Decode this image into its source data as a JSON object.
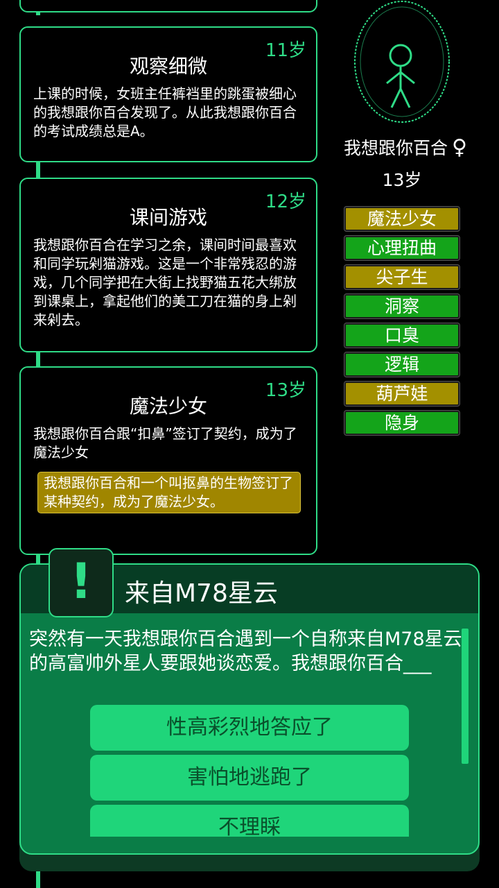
{
  "timeline": {
    "events": [
      {
        "age": "11岁",
        "title": "观察细微",
        "body": "上课的时候，女班主任裤裆里的跳蛋被细心的我想跟你百合发现了。从此我想跟你百合的考试成绩总是A。"
      },
      {
        "age": "12岁",
        "title": "课间游戏",
        "body": "我想跟你百合在学习之余，课间时间最喜欢和同学玩剁猫游戏。这是一个非常残忍的游戏，几个同学把在大街上找野猫五花大绑放到课桌上，拿起他们的美工刀在猫的身上剁来剁去。"
      },
      {
        "age": "13岁",
        "title": "魔法少女",
        "body": "我想跟你百合跟“扣鼻”签订了契约，成为了魔法少女",
        "note": "我想跟你百合和一个叫抠鼻的生物签订了某种契约，成为了魔法少女。"
      }
    ]
  },
  "profile": {
    "name": "我想跟你百合",
    "gender_symbol": "♀",
    "age": "13岁",
    "traits": [
      {
        "label": "魔法少女",
        "color": "gold"
      },
      {
        "label": "心理扭曲",
        "color": "green"
      },
      {
        "label": "尖子生",
        "color": "gold"
      },
      {
        "label": "洞察",
        "color": "green"
      },
      {
        "label": "口臭",
        "color": "green"
      },
      {
        "label": "逻辑",
        "color": "green"
      },
      {
        "label": "葫芦娃",
        "color": "gold"
      },
      {
        "label": "隐身",
        "color": "green"
      }
    ]
  },
  "dialog": {
    "badge": "!",
    "title": "来自M78星云",
    "text": "突然有一天我想跟你百合遇到一个自称来自M78星云的高富帅外星人要跟她谈恋爱。我想跟你百合___",
    "choices": [
      "性高彩烈地答应了",
      "害怕地逃跑了",
      "不理睬"
    ]
  },
  "colors": {
    "accent": "#2fdc87",
    "trait_gold": "#a39000",
    "trait_green": "#14a41a",
    "dialog_bg": "#0a7d47",
    "choice_bg": "#1fd57a"
  }
}
